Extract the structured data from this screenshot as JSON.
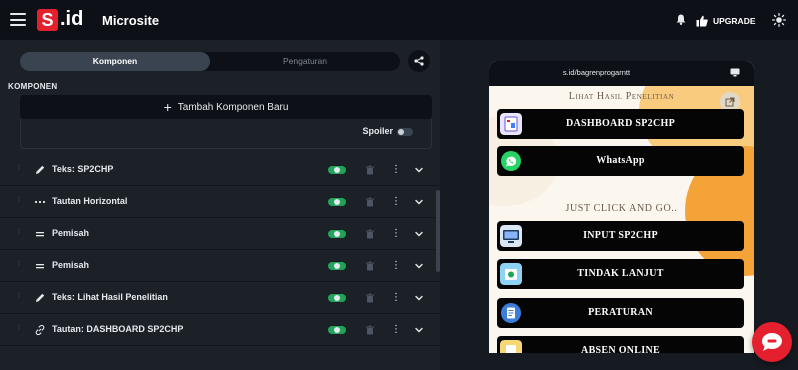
{
  "app": {
    "logo_letter": "S",
    "logo_suffix": ".id",
    "title": "Microsite",
    "upgrade_label": "UPGRADE",
    "accent": "#e5202e"
  },
  "tabs": [
    {
      "label": "Komponen",
      "active": true
    },
    {
      "label": "Pengaturan",
      "active": false
    }
  ],
  "section": {
    "label": "KOMPONEN",
    "add_label": "Tambah Komponen Baru",
    "spoiler_label": "Spoiler"
  },
  "components": [
    {
      "icon": "pencil-icon",
      "label": "Teks: SP2CHP",
      "enabled": true
    },
    {
      "icon": "dots-horizontal-icon",
      "label": "Tautan Horizontal",
      "enabled": true
    },
    {
      "icon": "equals-icon",
      "label": "Pemisah",
      "enabled": true
    },
    {
      "icon": "equals-icon",
      "label": "Pemisah",
      "enabled": true
    },
    {
      "icon": "pencil-icon",
      "label": "Teks: Lihat Hasil Penelitian",
      "enabled": true
    },
    {
      "icon": "link-icon",
      "label": "Tautan: DASHBOARD SP2CHP",
      "enabled": true
    }
  ],
  "preview": {
    "url": "s.id/bagrenprogarntt",
    "heading_1": "Lihat Hasil Penelitian",
    "heading_2": "JUST CLICK AND GO..",
    "links": [
      {
        "label": "DASHBOARD SP2CHP",
        "thumb": "dashboard-thumb-icon"
      },
      {
        "label": "WhatsApp",
        "thumb": "whatsapp-icon"
      },
      {
        "label": "INPUT SP2CHP",
        "thumb": "input-thumb-icon"
      },
      {
        "label": "TINDAK LANJUT",
        "thumb": "tindak-thumb-icon"
      },
      {
        "label": "PERATURAN",
        "thumb": "peraturan-thumb-icon"
      },
      {
        "label": "ABSEN ONLINE",
        "thumb": "absen-thumb-icon"
      }
    ]
  },
  "colors": {
    "toggle_on": "#22a55b",
    "panel_bg": "#1c2128",
    "page_bg": "#161b22"
  }
}
